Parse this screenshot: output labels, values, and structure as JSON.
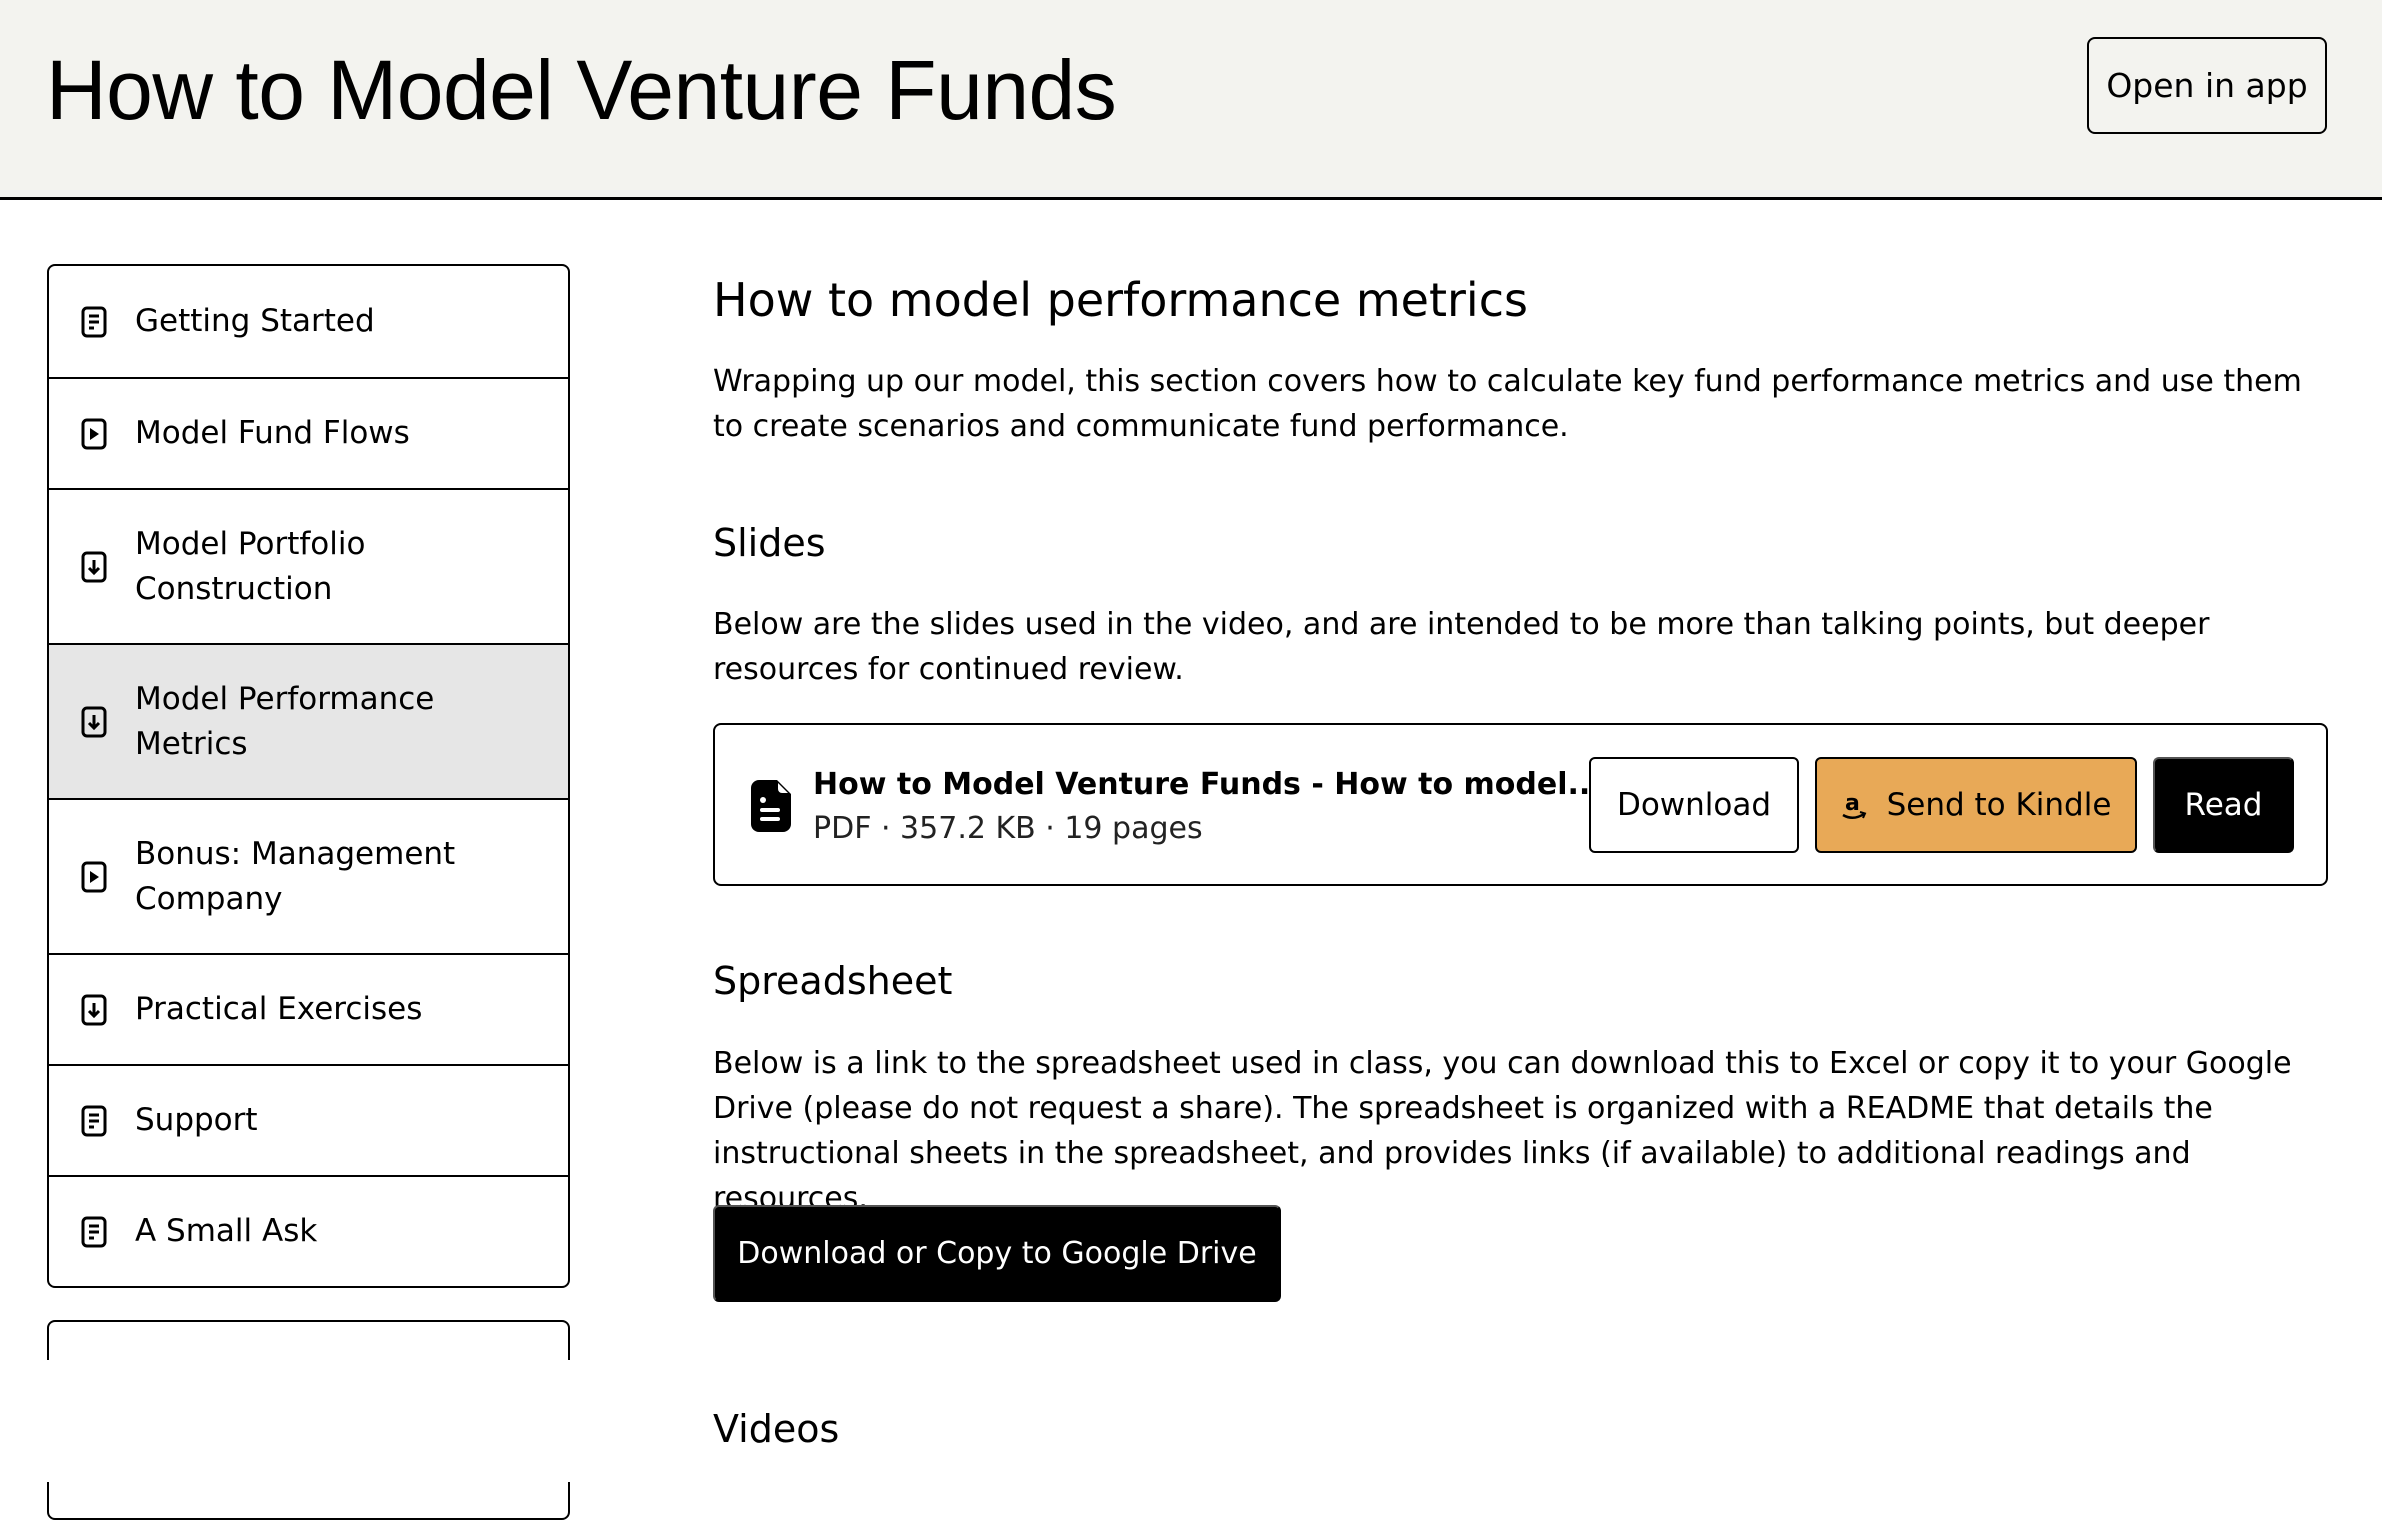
{
  "header": {
    "title": "How to Model Venture Funds",
    "open_in_app_label": "Open in app"
  },
  "sidebar": {
    "items": [
      {
        "label": "Getting Started",
        "icon": "document-icon",
        "active": false
      },
      {
        "label": "Model Fund Flows",
        "icon": "play-icon",
        "active": false
      },
      {
        "label": "Model Portfolio Construction",
        "icon": "download-icon",
        "active": false
      },
      {
        "label": "Model Performance Metrics",
        "icon": "download-icon",
        "active": true
      },
      {
        "label": "Bonus: Management Company",
        "icon": "play-icon",
        "active": false
      },
      {
        "label": "Practical Exercises",
        "icon": "download-icon",
        "active": false
      },
      {
        "label": "Support",
        "icon": "document-icon",
        "active": false
      },
      {
        "label": "A Small Ask",
        "icon": "document-icon",
        "active": false
      }
    ]
  },
  "main": {
    "title": "How to model performance metrics",
    "intro": "Wrapping up our model, this section covers how to calculate key fund performance metrics and use them to create scenarios and communicate fund performance.",
    "slides": {
      "heading": "Slides",
      "description": "Below are the slides used in the video, and are intended to be more than talking points, but deeper resources for continued review.",
      "file": {
        "name": "How to Model Venture Funds - How to model...",
        "meta": "PDF · 357.2 KB · 19 pages",
        "icon": "file-icon"
      },
      "download_label": "Download",
      "kindle_label": "Send to Kindle",
      "kindle_icon": "amazon-icon",
      "read_label": "Read"
    },
    "spreadsheet": {
      "heading": "Spreadsheet",
      "description": "Below is a link to the spreadsheet used in class, you can download this to Excel or copy it to your Google Drive (please do not request a share). The spreadsheet is organized with a README that details the instructional sheets in the spreadsheet, and provides links (if available) to additional readings and resources.",
      "button_label": "Download or Copy to Google Drive"
    },
    "videos": {
      "heading": "Videos"
    }
  },
  "colors": {
    "header_bg": "#f3f3ef",
    "active_nav_bg": "#e6e6e6",
    "kindle_button": "#e8a957",
    "primary_button": "#000000"
  }
}
